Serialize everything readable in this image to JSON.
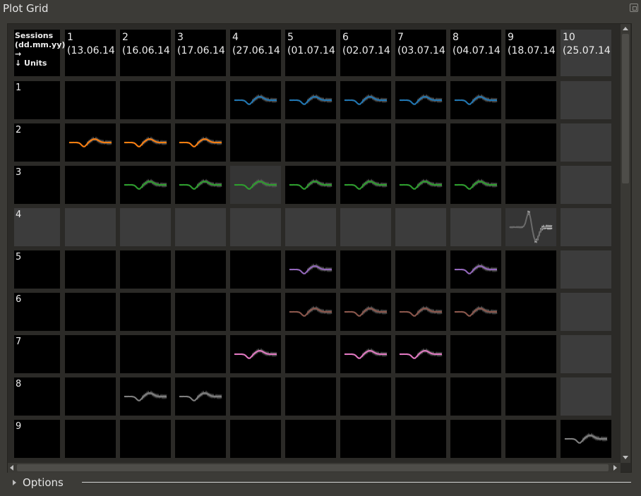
{
  "window": {
    "title": "Plot Grid"
  },
  "corner": {
    "line1": "Sessions",
    "line2": "(dd.mm.yy)",
    "line3": "→",
    "line4": "↓ Units"
  },
  "sessions": [
    {
      "num": "1",
      "date": "(13.06.14"
    },
    {
      "num": "2",
      "date": "(16.06.14"
    },
    {
      "num": "3",
      "date": "(17.06.14"
    },
    {
      "num": "4",
      "date": "(27.06.14"
    },
    {
      "num": "5",
      "date": "(01.07.14"
    },
    {
      "num": "6",
      "date": "(02.07.14"
    },
    {
      "num": "7",
      "date": "(03.07.14"
    },
    {
      "num": "8",
      "date": "(04.07.14"
    },
    {
      "num": "9",
      "date": "(18.07.14"
    },
    {
      "num": "10",
      "date": "(25.07.14"
    }
  ],
  "units": [
    {
      "label": "1",
      "color": "#1f77b4",
      "sessions": [
        4,
        5,
        6,
        7,
        8
      ]
    },
    {
      "label": "2",
      "color": "#ff7f0e",
      "sessions": [
        1,
        2,
        3
      ]
    },
    {
      "label": "3",
      "color": "#2ca02c",
      "sessions": [
        2,
        3,
        4,
        5,
        6,
        7,
        8
      ]
    },
    {
      "label": "4",
      "color": "#aaaaaa",
      "sessions": [
        9
      ]
    },
    {
      "label": "5",
      "color": "#9467bd",
      "sessions": [
        5,
        8
      ]
    },
    {
      "label": "6",
      "color": "#8c564b",
      "sessions": [
        5,
        6,
        7,
        8
      ]
    },
    {
      "label": "7",
      "color": "#e377c2",
      "sessions": [
        4,
        6,
        7
      ]
    },
    {
      "label": "8",
      "color": "#7f7f7f",
      "sessions": [
        2,
        3
      ]
    },
    {
      "label": "9",
      "color": "#7f7f7f",
      "sessions": [
        10
      ]
    }
  ],
  "colors": {
    "empty_cell": "#000000",
    "unavailable_cell": "#3c3c3c",
    "highlighted_cell": "#353535",
    "background": "#3c3b37"
  },
  "options": {
    "label": "Options"
  },
  "icons": {
    "float": "float-window-icon",
    "expand": "expand-triangle-icon",
    "scroll_up": "arrow-up-icon",
    "scroll_down": "arrow-down-icon",
    "scroll_left": "arrow-left-icon",
    "scroll_right": "arrow-right-icon"
  }
}
